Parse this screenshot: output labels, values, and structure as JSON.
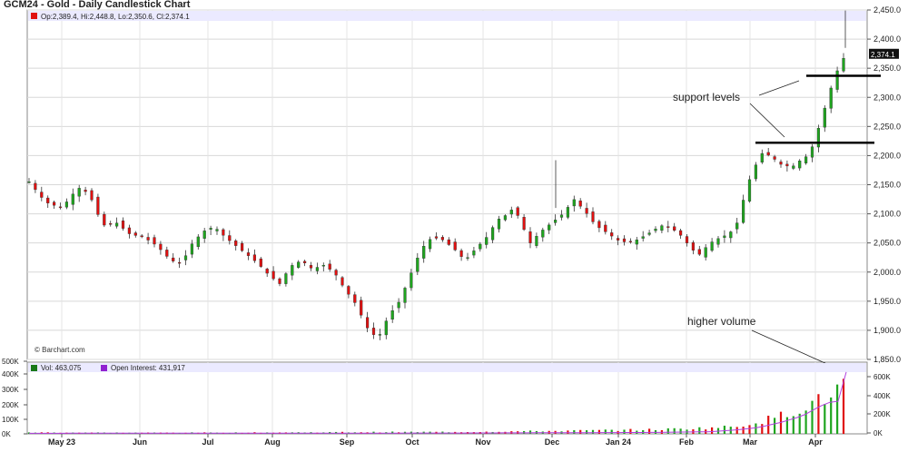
{
  "header": {
    "title": "GCM24 - Gold - Daily Candlestick Chart",
    "ohlc_text": "Op:2,389.4, Hi:2,448.8, Lo:2,350.6, Cl:2,374.1",
    "last_price_tag": "2,374.1",
    "watermark": "© Barchart.com"
  },
  "volume_panel": {
    "vol_legend": "Vol: 463,075",
    "oi_legend": "Open Interest: 431,917",
    "left_ticks": [
      "500K",
      "400K",
      "300K",
      "200K",
      "100K",
      "0K"
    ],
    "right_ticks": [
      "600K",
      "400K",
      "200K",
      "0K"
    ]
  },
  "annotations": {
    "support": "support levels",
    "volume": "higher volume"
  },
  "colors": {
    "up": "#1fa51f",
    "down": "#e01010",
    "oi_line": "#b040e0",
    "legend_bg": "#ebeaff"
  },
  "chart_data": {
    "type": "candlestick",
    "y_ticks": [
      "2,450.0",
      "2,400.0",
      "2,350.0",
      "2,300.0",
      "2,250.0",
      "2,200.0",
      "2,150.0",
      "2,100.0",
      "2,050.0",
      "2,000.0",
      "1,950.0",
      "1,900.0",
      "1,850.0"
    ],
    "ylim": [
      1850,
      2450
    ],
    "x_labels": [
      "May 23",
      "Jun",
      "Jul",
      "Aug",
      "Sep",
      "Oct",
      "Nov",
      "Dec",
      "Jan 24",
      "Feb",
      "Mar",
      "Apr"
    ],
    "support_levels": [
      2222,
      2337
    ],
    "price_path": [
      [
        0,
        2155
      ],
      [
        6,
        2120
      ],
      [
        12,
        2110
      ],
      [
        18,
        2145
      ],
      [
        22,
        2135
      ],
      [
        27,
        2080
      ],
      [
        32,
        2085
      ],
      [
        37,
        2065
      ],
      [
        42,
        2060
      ],
      [
        47,
        2045
      ],
      [
        52,
        2020
      ],
      [
        56,
        2015
      ],
      [
        60,
        2050
      ],
      [
        64,
        2070
      ],
      [
        68,
        2078
      ],
      [
        72,
        2060
      ],
      [
        76,
        2045
      ],
      [
        80,
        2030
      ],
      [
        84,
        2015
      ],
      [
        88,
        1995
      ],
      [
        92,
        1980
      ],
      [
        96,
        2010
      ],
      [
        100,
        2020
      ],
      [
        104,
        2005
      ],
      [
        108,
        2012
      ],
      [
        112,
        2000
      ],
      [
        116,
        1970
      ],
      [
        120,
        1945
      ],
      [
        124,
        1905
      ],
      [
        128,
        1885
      ],
      [
        132,
        1925
      ],
      [
        136,
        1950
      ],
      [
        140,
        1995
      ],
      [
        144,
        2040
      ],
      [
        148,
        2060
      ],
      [
        152,
        2055
      ],
      [
        156,
        2040
      ],
      [
        160,
        2020
      ],
      [
        164,
        2040
      ],
      [
        168,
        2060
      ],
      [
        172,
        2090
      ],
      [
        176,
        2100
      ],
      [
        178,
        2112
      ],
      [
        181,
        2080
      ],
      [
        184,
        2050
      ],
      [
        188,
        2070
      ],
      [
        192,
        2085
      ],
      [
        196,
        2100
      ],
      [
        200,
        2125
      ],
      [
        204,
        2105
      ],
      [
        208,
        2080
      ],
      [
        212,
        2068
      ],
      [
        216,
        2055
      ],
      [
        220,
        2050
      ],
      [
        224,
        2057
      ],
      [
        228,
        2068
      ],
      [
        232,
        2080
      ],
      [
        236,
        2075
      ],
      [
        240,
        2060
      ],
      [
        243,
        2040
      ],
      [
        246,
        2030
      ],
      [
        250,
        2050
      ],
      [
        254,
        2060
      ],
      [
        257,
        2065
      ],
      [
        260,
        2085
      ],
      [
        262,
        2120
      ],
      [
        264,
        2155
      ],
      [
        266,
        2170
      ],
      [
        268,
        2205
      ],
      [
        272,
        2200
      ],
      [
        276,
        2185
      ],
      [
        280,
        2180
      ],
      [
        284,
        2195
      ],
      [
        286,
        2200
      ],
      [
        288,
        2220
      ],
      [
        290,
        2250
      ],
      [
        292,
        2280
      ],
      [
        294,
        2310
      ],
      [
        296,
        2340
      ],
      [
        298,
        2356
      ],
      [
        300,
        2378
      ]
    ],
    "volume_series": [
      [
        0,
        10
      ],
      [
        40,
        8
      ],
      [
        80,
        9
      ],
      [
        120,
        12
      ],
      [
        160,
        14
      ],
      [
        200,
        22
      ],
      [
        230,
        30
      ],
      [
        250,
        42
      ],
      [
        260,
        52
      ],
      [
        265,
        75
      ],
      [
        270,
        95
      ],
      [
        275,
        125
      ],
      [
        280,
        150
      ],
      [
        285,
        200
      ],
      [
        290,
        230
      ],
      [
        295,
        270
      ],
      [
        297,
        310
      ],
      [
        299,
        350
      ],
      [
        300,
        463
      ]
    ],
    "open_interest_series": [
      [
        0,
        4
      ],
      [
        120,
        5
      ],
      [
        160,
        6
      ],
      [
        200,
        8
      ],
      [
        230,
        10
      ],
      [
        250,
        15
      ],
      [
        260,
        28
      ],
      [
        268,
        45
      ],
      [
        276,
        80
      ],
      [
        284,
        125
      ],
      [
        290,
        190
      ],
      [
        294,
        220
      ],
      [
        298,
        230
      ],
      [
        300,
        431
      ]
    ]
  }
}
